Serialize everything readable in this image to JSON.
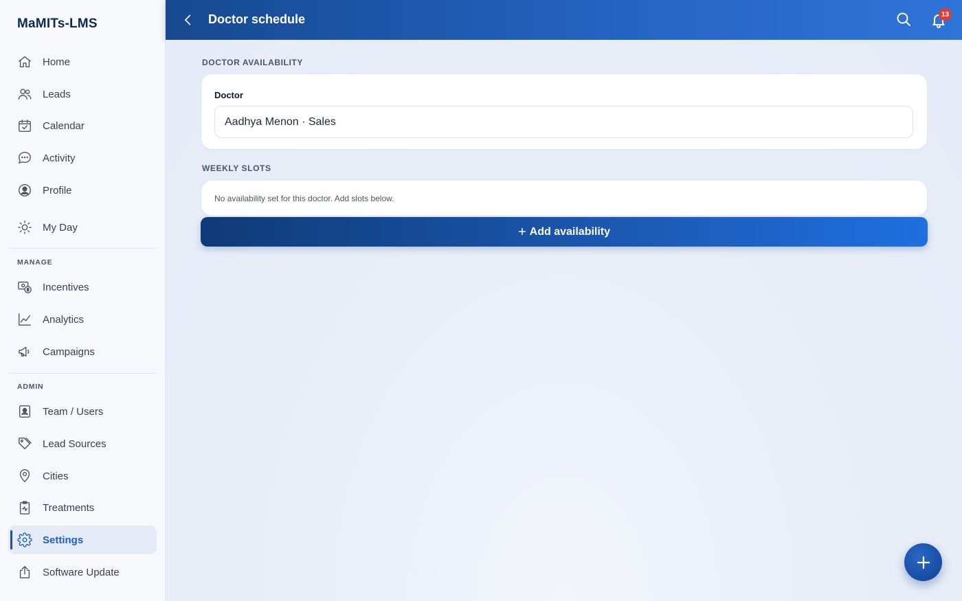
{
  "brand": "MaMITs-LMS",
  "sidebar": {
    "items": [
      {
        "label": "Home",
        "icon": "home-icon"
      },
      {
        "label": "Leads",
        "icon": "users-icon"
      },
      {
        "label": "Calendar",
        "icon": "calendar-icon"
      },
      {
        "label": "Activity",
        "icon": "chat-icon"
      },
      {
        "label": "Profile",
        "icon": "profile-icon"
      },
      {
        "label": "My Day",
        "icon": "sun-icon"
      }
    ],
    "manage_label": "MANAGE",
    "manage_items": [
      {
        "label": "Incentives",
        "icon": "money-icon"
      },
      {
        "label": "Analytics",
        "icon": "chart-icon"
      },
      {
        "label": "Campaigns",
        "icon": "megaphone-icon"
      }
    ],
    "admin_label": "ADMIN",
    "admin_items": [
      {
        "label": "Team / Users",
        "icon": "id-badge-icon"
      },
      {
        "label": "Lead Sources",
        "icon": "tag-icon"
      },
      {
        "label": "Cities",
        "icon": "map-pin-icon"
      },
      {
        "label": "Treatments",
        "icon": "clipboard-icon"
      },
      {
        "label": "Settings",
        "icon": "gear-icon",
        "active": true
      },
      {
        "label": "Software Update",
        "icon": "share-icon"
      }
    ]
  },
  "header": {
    "title": "Doctor schedule",
    "notification_count": "13"
  },
  "availability": {
    "section_title": "DOCTOR AVAILABILITY",
    "doctor_label": "Doctor",
    "doctor_value": "Aadhya Menon · Sales"
  },
  "slots": {
    "section_title": "WEEKLY SLOTS",
    "empty_message": "No availability set for this doctor. Add slots below.",
    "add_button": "Add availability"
  },
  "colors": {
    "accent": "#1d5fc9",
    "header_start": "#16498f",
    "header_end": "#2f74d8",
    "badge": "#e53935"
  }
}
